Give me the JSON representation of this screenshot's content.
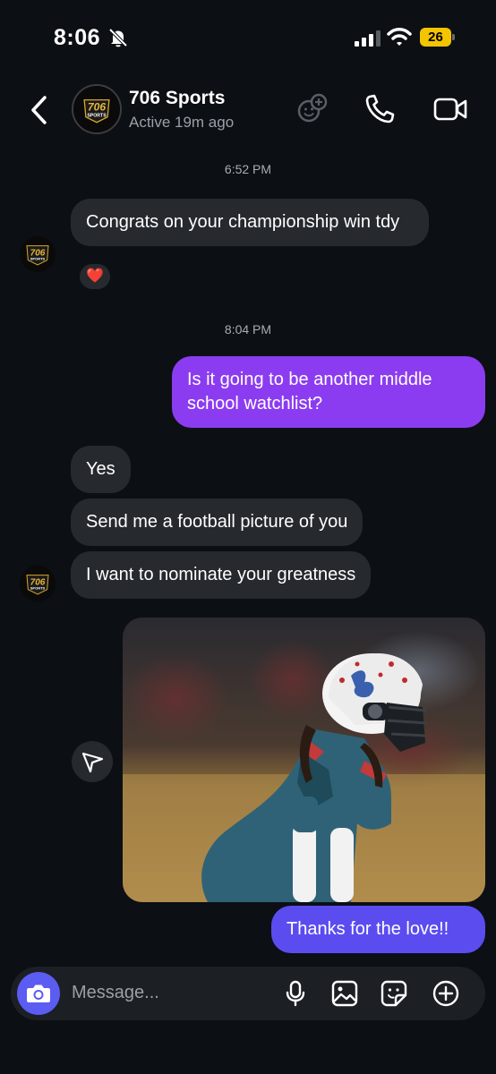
{
  "status_bar": {
    "time": "8:06",
    "battery": "26"
  },
  "header": {
    "title": "706 Sports",
    "subtitle": "Active 19m ago"
  },
  "avatar_logo": {
    "number": "706",
    "word": "SPORTS",
    "tag": "MEDIA"
  },
  "messages": {
    "timestamp_1": "6:52 PM",
    "in_1": "Congrats on your championship win tdy",
    "reaction_1": "❤️",
    "timestamp_2": "8:04 PM",
    "out_1": "Is it going to be another middle school watchlist?",
    "in_2": "Yes",
    "in_3": "Send me a football picture of you",
    "in_4": "I want to nominate your greatness",
    "out_2": "Thanks for the love!!"
  },
  "composer": {
    "placeholder": "Message..."
  },
  "colors": {
    "background": "#0c0f14",
    "incoming_bubble": "#26292e",
    "outgoing_purple": "#8c3cf0",
    "outgoing_indigo": "#5b4cf0",
    "camera_button": "#5b5cf2",
    "battery": "#f5c400"
  }
}
